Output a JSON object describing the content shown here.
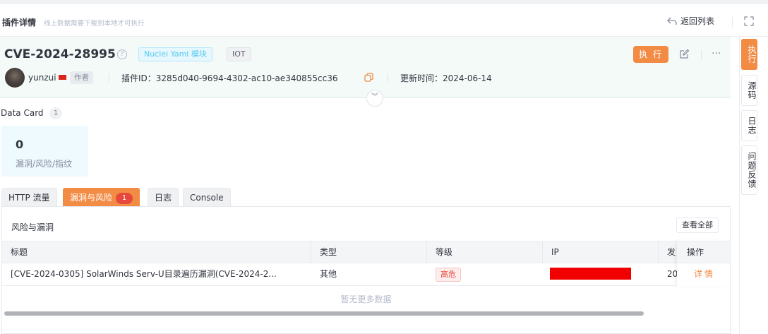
{
  "header": {
    "title": "插件详情",
    "subtitle": "线上数据需要下载到本地才可执行",
    "back_label": "返回列表"
  },
  "plugin": {
    "name": "CVE-2024-28995",
    "type_tag": "Nuclei Yaml 模块",
    "category_tag": "IOT",
    "exec_label": "执 行",
    "author": "yunzui",
    "author_tag": "作者",
    "plugin_id": "插件ID：3285d040-9694-4302-ac10-ae340855cc36",
    "update_time": "更新时间：2024-06-14"
  },
  "data_card": {
    "label": "Data Card",
    "count": "1",
    "cards": [
      {
        "value": "0",
        "label": "漏洞/风险/指纹"
      }
    ]
  },
  "tabs": [
    {
      "label": "HTTP 流量"
    },
    {
      "label": "漏洞与风险",
      "badge": "1"
    },
    {
      "label": "日志"
    },
    {
      "label": "Console"
    }
  ],
  "risk_panel": {
    "title": "风险与漏洞",
    "view_all": "查看全部",
    "columns": [
      "标题",
      "类型",
      "等级",
      "IP",
      "发",
      "操作"
    ],
    "rows": [
      {
        "title": "[CVE-2024-0305] SolarWinds Serv-U目录遍历漏洞(CVE-2024-2...",
        "type": "其他",
        "level": "高危",
        "time_prefix": "20",
        "action": "详情"
      }
    ],
    "empty_text": "暂无更多数据"
  },
  "side_tabs": [
    {
      "label": "执行"
    },
    {
      "label": "源码"
    },
    {
      "label": "日志"
    },
    {
      "label": "问题反馈"
    }
  ],
  "colors": {
    "accent": "#f28b44",
    "danger": "#e6493c",
    "info_bg": "#f3faf7"
  }
}
